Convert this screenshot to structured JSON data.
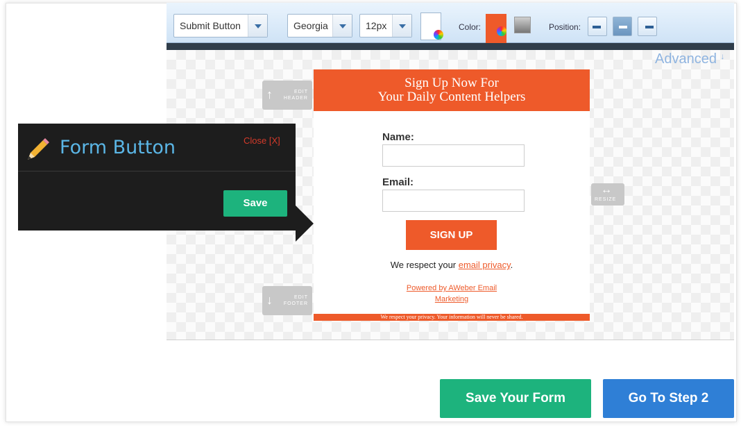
{
  "toolbar": {
    "element_select": "Submit Button",
    "font_select": "Georgia",
    "size_select": "12px",
    "color_label": "Color:",
    "position_label": "Position:"
  },
  "canvas": {
    "advanced_label": "Advanced",
    "edit_header": "EDIT\nHEADER",
    "edit_footer": "EDIT\nFOOTER",
    "resize": "RESIZE"
  },
  "form": {
    "header_line1": "Sign Up Now For",
    "header_line2": "Your Daily Content Helpers",
    "name_label": "Name:",
    "email_label": "Email:",
    "signup_label": "SIGN UP",
    "respect_prefix": "We respect your ",
    "privacy_link": "email privacy",
    "respect_suffix": ".",
    "powered_line1": "Powered by AWeber Email",
    "powered_line2": "Marketing",
    "footer_text": "We respect your privacy. Your information will never be shared."
  },
  "popover": {
    "title": "Form Button",
    "close_label": "Close [X]",
    "save_label": "Save"
  },
  "actions": {
    "save_form_label": "Save Your Form",
    "go_step_label": "Go To Step 2"
  },
  "colors": {
    "accent_orange": "#ee5a2a",
    "save_green": "#1db37d",
    "step_blue": "#2f7fd6",
    "popover_title_blue": "#5bb6e6"
  }
}
